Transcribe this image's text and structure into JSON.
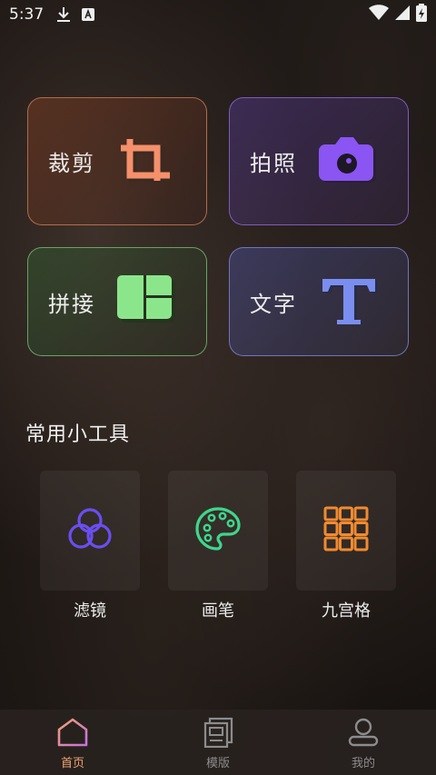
{
  "status_bar": {
    "time": "5:37",
    "icons": [
      "download-icon",
      "text-a-icon",
      "wifi-icon",
      "signal-icon",
      "battery-charging-icon"
    ]
  },
  "feature_cards": [
    {
      "label": "裁剪",
      "icon": "crop-icon",
      "accent": "#f08a5c"
    },
    {
      "label": "拍照",
      "icon": "camera-icon",
      "accent": "#8e5cf0"
    },
    {
      "label": "拼接",
      "icon": "collage-icon",
      "accent": "#8ae68a"
    },
    {
      "label": "文字",
      "icon": "text-t-icon",
      "accent": "#7a8ee8"
    }
  ],
  "tools_section": {
    "title": "常用小工具",
    "tools": [
      {
        "label": "滤镜",
        "icon": "filter-circles-icon",
        "accent": "#6a4ef0"
      },
      {
        "label": "画笔",
        "icon": "palette-icon",
        "accent": "#3ed68c"
      },
      {
        "label": "九宫格",
        "icon": "grid-nine-icon",
        "accent": "#f08a30"
      }
    ]
  },
  "bottom_nav": {
    "items": [
      {
        "label": "首页",
        "icon": "home-icon",
        "active": true
      },
      {
        "label": "模版",
        "icon": "template-icon",
        "active": false
      },
      {
        "label": "我的",
        "icon": "profile-icon",
        "active": false
      }
    ],
    "active_color": "#f0a574"
  }
}
